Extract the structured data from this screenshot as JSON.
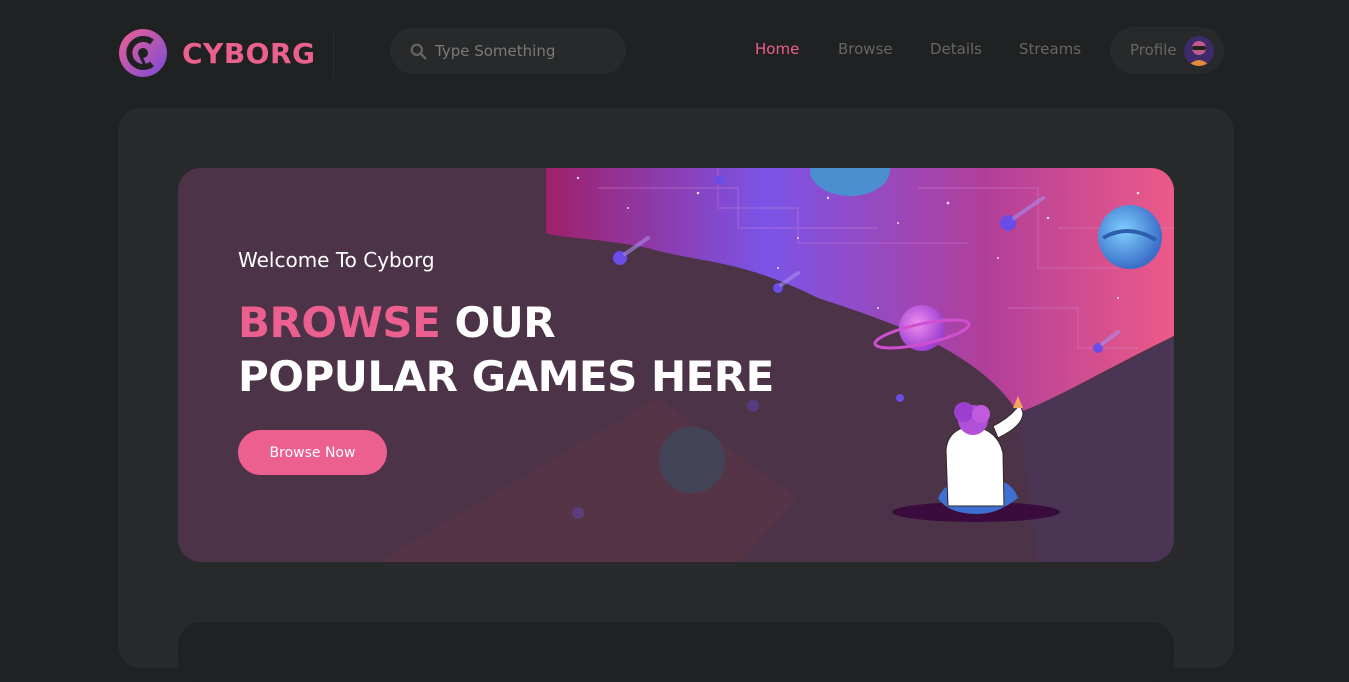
{
  "brand": {
    "name": "CYBORG",
    "accent_color": "#ec6090",
    "logo_icon": "cyborg-logo-icon"
  },
  "search": {
    "placeholder": "Type Something",
    "icon": "search-icon"
  },
  "nav": {
    "items": [
      {
        "label": "Home",
        "active": true
      },
      {
        "label": "Browse",
        "active": false
      },
      {
        "label": "Details",
        "active": false
      },
      {
        "label": "Streams",
        "active": false
      }
    ],
    "profile_label": "Profile",
    "profile_icon": "avatar"
  },
  "banner": {
    "welcome": "Welcome To Cyborg",
    "headline_highlight": "BROWSE",
    "headline_rest_1": "OUR",
    "headline_line_2": "POPULAR GAMES HERE",
    "button_label": "Browse Now"
  },
  "colors": {
    "background": "#1f2122",
    "card": "#27292a",
    "muted_text": "#666666"
  }
}
